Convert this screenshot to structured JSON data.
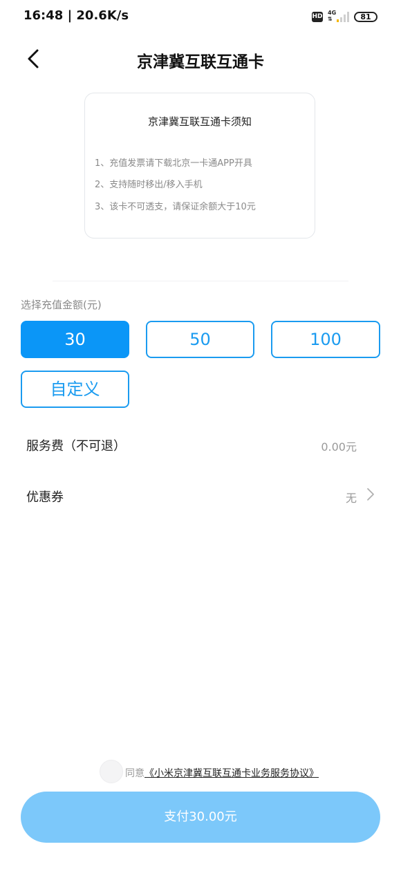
{
  "status_bar": {
    "time_speed": "16:48 | 20.6K/s",
    "hd": "HD",
    "network": "4G",
    "battery": "81"
  },
  "header": {
    "title": "京津冀互联互通卡"
  },
  "notice": {
    "title": "京津冀互联互通卡须知",
    "lines": [
      "1、充值发票请下载北京一卡通APP开具",
      "2、支持随时移出/移入手机",
      "3、该卡不可透支，请保证余额大于10元"
    ]
  },
  "amount": {
    "label": "选择充值金额(元)",
    "options": [
      "30",
      "50",
      "100",
      "自定义"
    ],
    "selected": "30"
  },
  "service_fee": {
    "label": "服务费（不可退）",
    "value": "0.00元"
  },
  "coupon": {
    "label": "优惠券",
    "value": "无"
  },
  "agreement": {
    "prefix": "同意",
    "link": "《小米京津冀互联互通卡业务服务协议》"
  },
  "pay_button": {
    "label": "支付30.00元"
  },
  "colors": {
    "accent": "#0b96f7",
    "pay_button": "#7cc8fa"
  }
}
